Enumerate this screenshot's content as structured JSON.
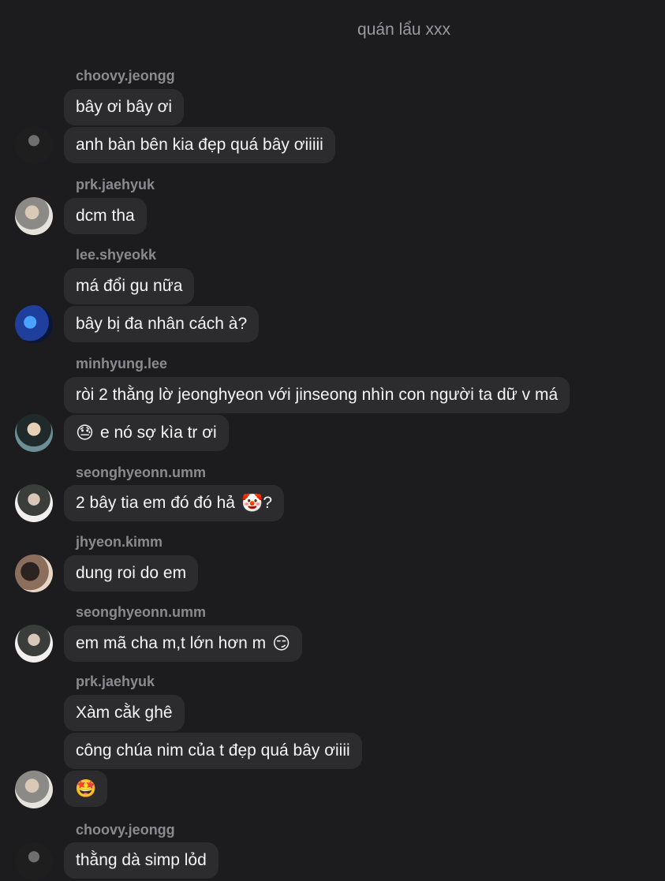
{
  "header": {
    "title": "quán lẩu xxx"
  },
  "messages": [
    {
      "username": "choovy.jeongg",
      "bubbles": [
        {
          "text": "bây ơi bây ơi"
        },
        {
          "text": "anh bàn bên kia đẹp quá bây ơiiiii"
        }
      ],
      "avatar": "avatar-dark-jersey"
    },
    {
      "username": "prk.jaehyuk",
      "bubbles": [
        {
          "text": "dcm tha"
        }
      ],
      "avatar": "avatar-hand-pose"
    },
    {
      "username": "lee.shyeokk",
      "bubbles": [
        {
          "text": "má đổi gu nữa"
        },
        {
          "text": "bây bị đa nhân cách à?"
        }
      ],
      "avatar": "avatar-blue-light"
    },
    {
      "username": "minhyung.lee",
      "bubbles": [
        {
          "text": "ròi 2 thằng lờ jeonghyeon với jinseong nhìn con người ta dữ v má"
        },
        {
          "emoji": "😓",
          "text": "e nó sợ kìa tr ơi"
        }
      ],
      "avatar": "avatar-outdoor"
    },
    {
      "username": "seonghyeonn.umm",
      "bubbles": [
        {
          "text": "2 bây tia em đó đó hả",
          "emoji_after": "🤡",
          "suffix": "?"
        }
      ],
      "avatar": "avatar-white-jacket"
    },
    {
      "username": "jhyeon.kimm",
      "bubbles": [
        {
          "text": "dung roi do em"
        }
      ],
      "avatar": "avatar-mirror-selfie"
    },
    {
      "username": "seonghyeonn.umm",
      "bubbles": [
        {
          "text": "em mã cha m,t lớn hơn m",
          "emoji_after": "😏"
        }
      ],
      "avatar": "avatar-white-jacket"
    },
    {
      "username": "prk.jaehyuk",
      "bubbles": [
        {
          "text": "Xàm cằk ghê"
        },
        {
          "text": "công chúa nim của t đẹp quá bây ơiiii"
        },
        {
          "emoji": "🤩"
        }
      ],
      "avatar": "avatar-hand-pose"
    },
    {
      "username": "choovy.jeongg",
      "bubbles": [
        {
          "text": "thằng dà simp lỏd"
        }
      ],
      "avatar": "avatar-dark-jersey"
    }
  ]
}
